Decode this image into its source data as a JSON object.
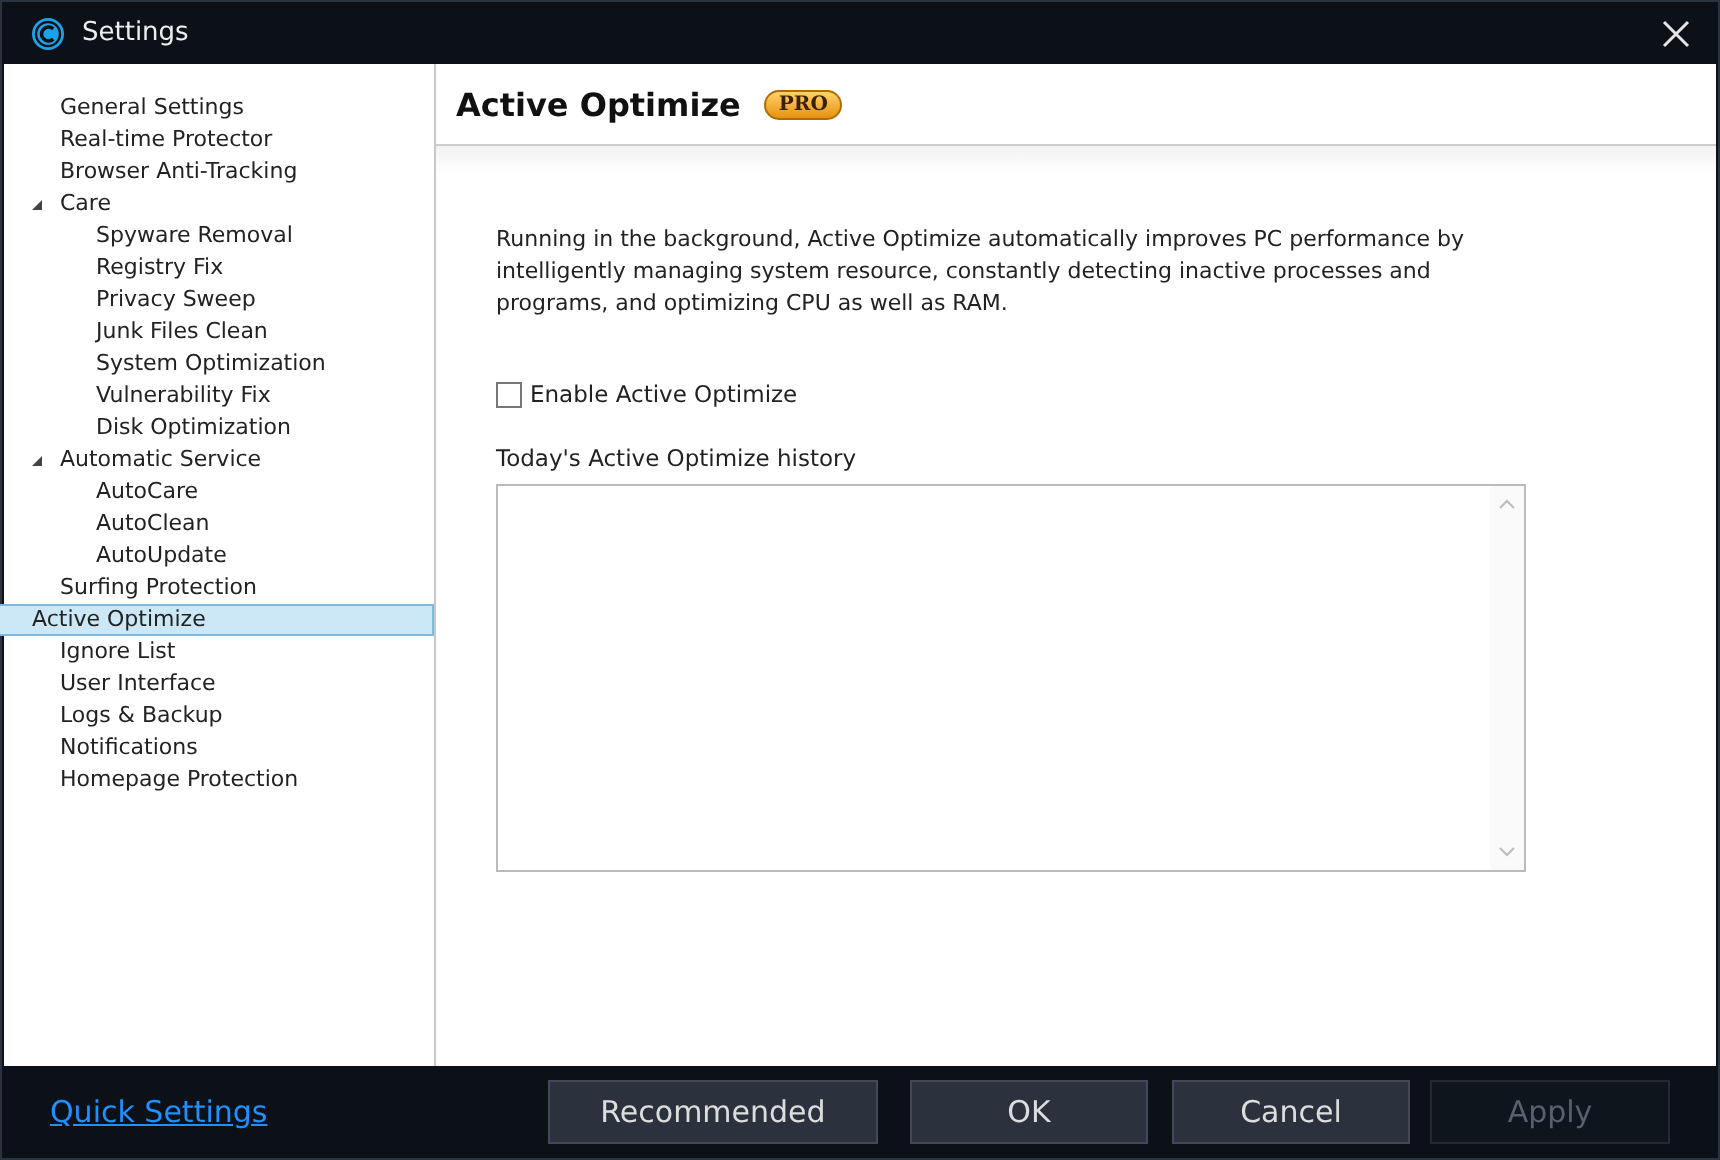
{
  "window": {
    "title": "Settings"
  },
  "sidebar": {
    "items": [
      {
        "label": "General Settings",
        "selected": false
      },
      {
        "label": "Real-time Protector",
        "selected": false
      },
      {
        "label": "Browser Anti-Tracking",
        "selected": false
      },
      {
        "label": "Care",
        "selected": false,
        "expanded": true,
        "children": [
          {
            "label": "Spyware Removal",
            "selected": false
          },
          {
            "label": "Registry Fix",
            "selected": false
          },
          {
            "label": "Privacy Sweep",
            "selected": false
          },
          {
            "label": "Junk Files Clean",
            "selected": false
          },
          {
            "label": "System Optimization",
            "selected": false
          },
          {
            "label": "Vulnerability Fix",
            "selected": false
          },
          {
            "label": "Disk Optimization",
            "selected": false
          }
        ]
      },
      {
        "label": "Automatic Service",
        "selected": false,
        "expanded": true,
        "children": [
          {
            "label": "AutoCare",
            "selected": false
          },
          {
            "label": "AutoClean",
            "selected": false
          },
          {
            "label": "AutoUpdate",
            "selected": false
          }
        ]
      },
      {
        "label": "Surfing Protection",
        "selected": false
      },
      {
        "label": "Active Optimize",
        "selected": true
      },
      {
        "label": "Ignore List",
        "selected": false
      },
      {
        "label": "User Interface",
        "selected": false
      },
      {
        "label": "Logs & Backup",
        "selected": false
      },
      {
        "label": "Notifications",
        "selected": false
      },
      {
        "label": "Homepage Protection",
        "selected": false
      }
    ]
  },
  "page": {
    "title": "Active Optimize",
    "badge": "PRO",
    "description": "Running in the background, Active Optimize automatically improves PC performance by intelligently managing system resource, constantly detecting inactive processes and programs, and optimizing CPU as well as RAM.",
    "enable_checkbox": {
      "label": "Enable Active Optimize",
      "checked": false
    },
    "history": {
      "label": "Today's Active Optimize history"
    }
  },
  "footer": {
    "link": "Quick Settings",
    "buttons": [
      {
        "label": "Recommended",
        "disabled": false
      },
      {
        "label": "OK",
        "disabled": false
      },
      {
        "label": "Cancel",
        "disabled": false
      },
      {
        "label": "Apply",
        "disabled": true
      }
    ]
  }
}
